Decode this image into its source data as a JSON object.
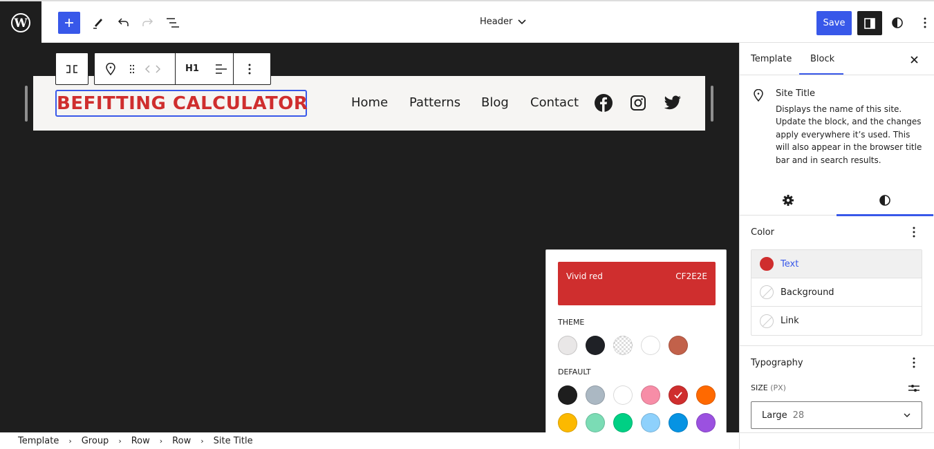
{
  "topbar": {
    "document_title": "Header",
    "save_label": "Save"
  },
  "canvas": {
    "site_title": "BEFITTING CALCULATOR",
    "nav_items": [
      "Home",
      "Patterns",
      "Blog",
      "Contact"
    ],
    "social_icons": [
      "facebook-icon",
      "instagram-icon",
      "twitter-icon"
    ],
    "block_toolbar": {
      "heading_level": "H1"
    }
  },
  "sidebar": {
    "tabs": [
      {
        "label": "Template",
        "active": false
      },
      {
        "label": "Block",
        "active": true
      }
    ],
    "block_card": {
      "title": "Site Title",
      "description": "Displays the name of this site. Update the block, and the changes apply everywhere it’s used. This will also appear in the browser title bar and in search results."
    },
    "inspector_tabs": [
      {
        "icon": "gear-icon",
        "label": "Settings",
        "active": false
      },
      {
        "icon": "contrast-icon",
        "label": "Styles",
        "active": true
      }
    ],
    "color_panel": {
      "title": "Color",
      "items": [
        {
          "label": "Text",
          "color": "#cf2e2e",
          "active": true
        },
        {
          "label": "Background",
          "color": null,
          "active": false
        },
        {
          "label": "Link",
          "color": null,
          "active": false
        }
      ]
    },
    "typography_panel": {
      "title": "Typography",
      "size_label": "SIZE",
      "size_unit": "(PX)",
      "size_name": "Large",
      "size_value": "28"
    }
  },
  "color_popover": {
    "selected_name": "Vivid red",
    "selected_hex": "CF2E2E",
    "theme_label": "THEME",
    "theme_colors": [
      "#e9e7e7",
      "#1f2126",
      "transparent",
      "#ffffff",
      "#c2614a"
    ],
    "default_label": "DEFAULT",
    "default_colors": [
      "#1e1e1e",
      "#abb8c3",
      "#ffffff",
      "#f78da7",
      "#cf2e2e",
      "#ff6900",
      "#fcb900",
      "#7bdcb5",
      "#00d084",
      "#8ed1fc",
      "#0693e3",
      "#9b51e0"
    ],
    "selected_default_index": 4
  },
  "breadcrumb": [
    "Template",
    "Group",
    "Row",
    "Row",
    "Site Title"
  ],
  "colors": {
    "accent": "#3858e9",
    "dark": "#1e1e1e",
    "vivid_red": "#cf2e2e"
  }
}
